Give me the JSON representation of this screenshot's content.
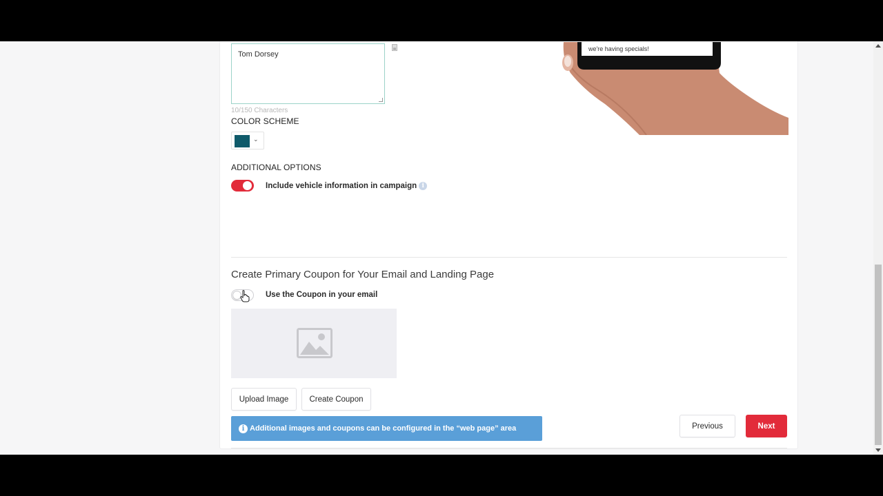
{
  "form": {
    "signature_text": "Tom Dorsey",
    "char_count": "10/150 Characters",
    "color_scheme_label": "COLOR SCHEME",
    "color_scheme_value": "#0f5a6a",
    "additional_options_label": "ADDITIONAL OPTIONS",
    "vehicle_info_toggle_label": "Include vehicle information in campaign",
    "vehicle_info_enabled": true
  },
  "preview": {
    "phone_message": "we're having specials!"
  },
  "coupon": {
    "title": "Create Primary Coupon for Your Email and Landing Page",
    "use_coupon_label": "Use the Coupon in your email",
    "use_coupon_enabled": false,
    "upload_button": "Upload Image",
    "create_button": "Create Coupon",
    "info_message": "Additional images and coupons can be configured in the “web page” area"
  },
  "nav": {
    "previous": "Previous",
    "next": "Next"
  }
}
